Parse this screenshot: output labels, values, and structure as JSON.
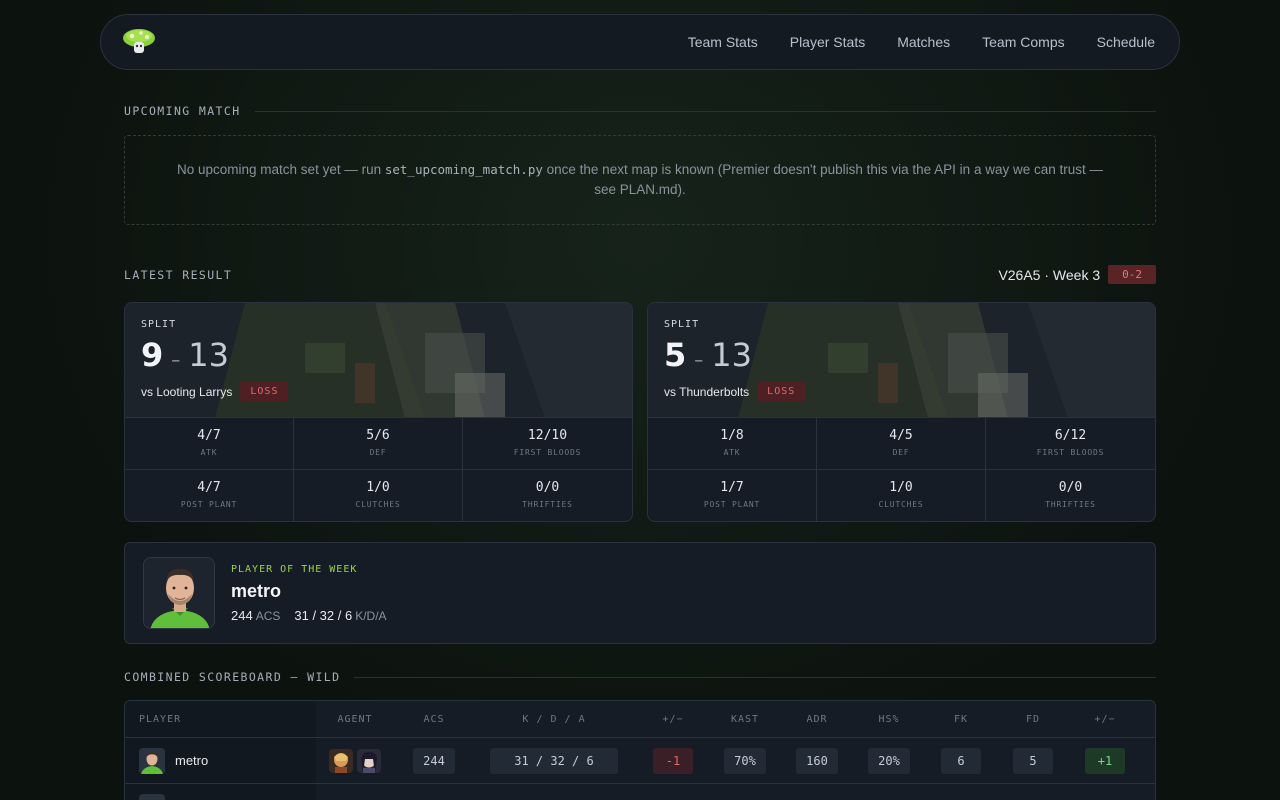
{
  "nav": {
    "links": [
      "Team Stats",
      "Player Stats",
      "Matches",
      "Team Comps",
      "Schedule"
    ],
    "logo_icon": "mushroom-logo-icon"
  },
  "upcoming": {
    "title": "UPCOMING MATCH",
    "message_before": "No upcoming match set yet — run ",
    "message_code": "set_upcoming_match.py",
    "message_after": " once the next map is known (Premier doesn't publish this via the API in a way we can trust — see PLAN.md)."
  },
  "latest": {
    "title": "LATEST RESULT",
    "week_label": "V26A5 · Week 3",
    "record": "0-2",
    "matches": [
      {
        "map": "SPLIT",
        "score_team": "9",
        "score_dash": "–",
        "score_opp": "13",
        "opponent": "vs Looting Larrys",
        "result": "LOSS",
        "stats": [
          {
            "value": "4/7",
            "label": "ATK"
          },
          {
            "value": "5/6",
            "label": "DEF"
          },
          {
            "value": "12/10",
            "label": "FIRST BLOODS"
          },
          {
            "value": "4/7",
            "label": "POST PLANT"
          },
          {
            "value": "1/0",
            "label": "CLUTCHES"
          },
          {
            "value": "0/0",
            "label": "THRIFTIES"
          }
        ]
      },
      {
        "map": "SPLIT",
        "score_team": "5",
        "score_dash": "–",
        "score_opp": "13",
        "opponent": "vs Thunderbolts",
        "result": "LOSS",
        "stats": [
          {
            "value": "1/8",
            "label": "ATK"
          },
          {
            "value": "4/5",
            "label": "DEF"
          },
          {
            "value": "6/12",
            "label": "FIRST BLOODS"
          },
          {
            "value": "1/7",
            "label": "POST PLANT"
          },
          {
            "value": "1/0",
            "label": "CLUTCHES"
          },
          {
            "value": "0/0",
            "label": "THRIFTIES"
          }
        ]
      }
    ]
  },
  "potw": {
    "tag": "PLAYER OF THE WEEK",
    "name": "metro",
    "acs": "244",
    "acs_unit": "ACS",
    "kda": "31 / 32 / 6",
    "kda_unit": "K/D/A"
  },
  "scoreboard": {
    "title": "COMBINED SCOREBOARD — WILD",
    "headers": [
      "PLAYER",
      "AGENT",
      "ACS",
      "K / D / A",
      "+/−",
      "KAST",
      "ADR",
      "HS%",
      "FK",
      "FD",
      "+/−"
    ],
    "rows": [
      {
        "player": "metro",
        "acs": "244",
        "kda": "31 / 32 /  6",
        "pm": "-1",
        "kast": "70%",
        "adr": "160",
        "hs": "20%",
        "fk": "6",
        "fd": "5",
        "pm2": "+1"
      }
    ]
  },
  "colors": {
    "accent_green": "#9bd24a",
    "loss_red": "#e26b6b",
    "positive_green": "#7ed38a"
  }
}
